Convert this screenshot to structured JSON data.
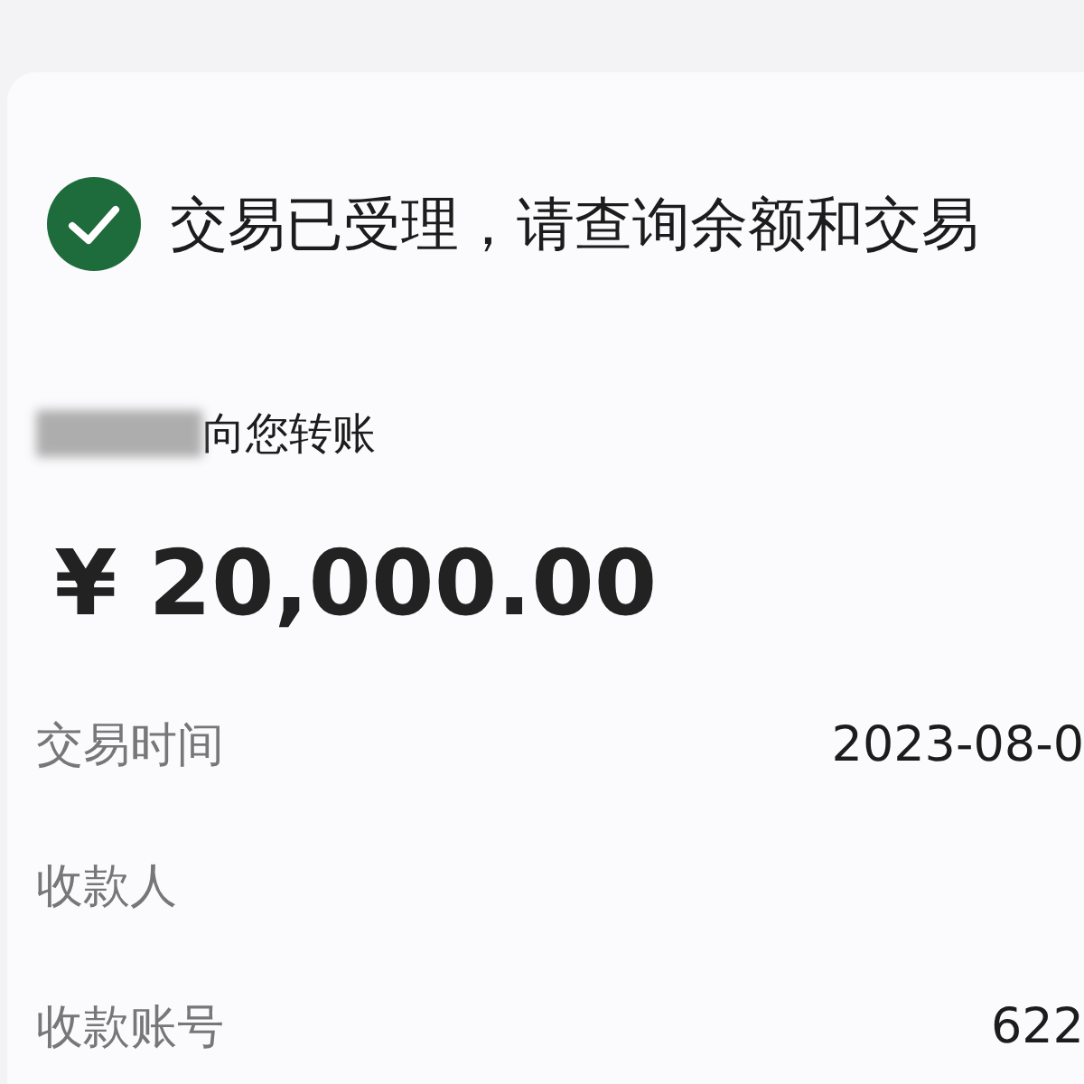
{
  "status": {
    "success": true,
    "message": "交易已受理，请查询余额和交易"
  },
  "transfer": {
    "sender_suffix": "向您转账",
    "amount": "¥ 20,000.00"
  },
  "details": [
    {
      "label": "交易时间",
      "value": "2023-08-0"
    },
    {
      "label": "收款人"
    },
    {
      "label": "收款账号",
      "value": "622"
    }
  ]
}
